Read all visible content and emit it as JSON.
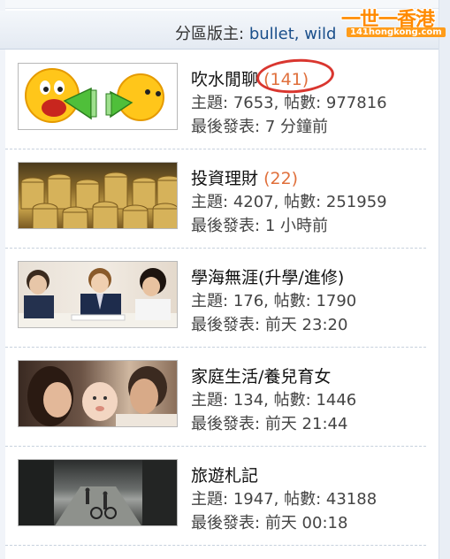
{
  "header": {
    "moderator_label": "分區版主:",
    "moderators": "bullet, wild"
  },
  "logo": {
    "main": "一世一香港",
    "sub": "141hongkong.com"
  },
  "forums": [
    {
      "icon": "emoticon-megaphone-icon",
      "title": "吹水閒聊",
      "count": "(141)",
      "stats_label": "主題:",
      "topics": "7653",
      "posts_label": "帖數:",
      "posts": "977816",
      "last_label": "最後發表:",
      "last_post": "7 分鐘前"
    },
    {
      "icon": "gold-coins-image",
      "title": "投資理財",
      "count": "(22)",
      "stats_label": "主題:",
      "topics": "4207",
      "posts_label": "帖數:",
      "posts": "251959",
      "last_label": "最後發表:",
      "last_post": "1 小時前"
    },
    {
      "icon": "students-studying-image",
      "title": "學海無涯(升學/進修)",
      "count": "",
      "stats_label": "主題:",
      "topics": "176",
      "posts_label": "帖數:",
      "posts": "1790",
      "last_label": "最後發表:",
      "last_post": "前天 23:20"
    },
    {
      "icon": "family-baby-image",
      "title": "家庭生活/養兒育女",
      "count": "",
      "stats_label": "主題:",
      "topics": "134",
      "posts_label": "帖數:",
      "posts": "1446",
      "last_label": "最後發表:",
      "last_post": "前天 21:44"
    },
    {
      "icon": "travel-street-image",
      "title": "旅遊札記",
      "count": "",
      "stats_label": "主題:",
      "topics": "1947",
      "posts_label": "帖數:",
      "posts": "43188",
      "last_label": "最後發表:",
      "last_post": "前天 00:18"
    }
  ],
  "colors": {
    "count_orange": "#e0703c",
    "annotation_red": "#d9362f",
    "link_blue": "#1a4f8b",
    "logo_orange": "#ff8a00"
  }
}
